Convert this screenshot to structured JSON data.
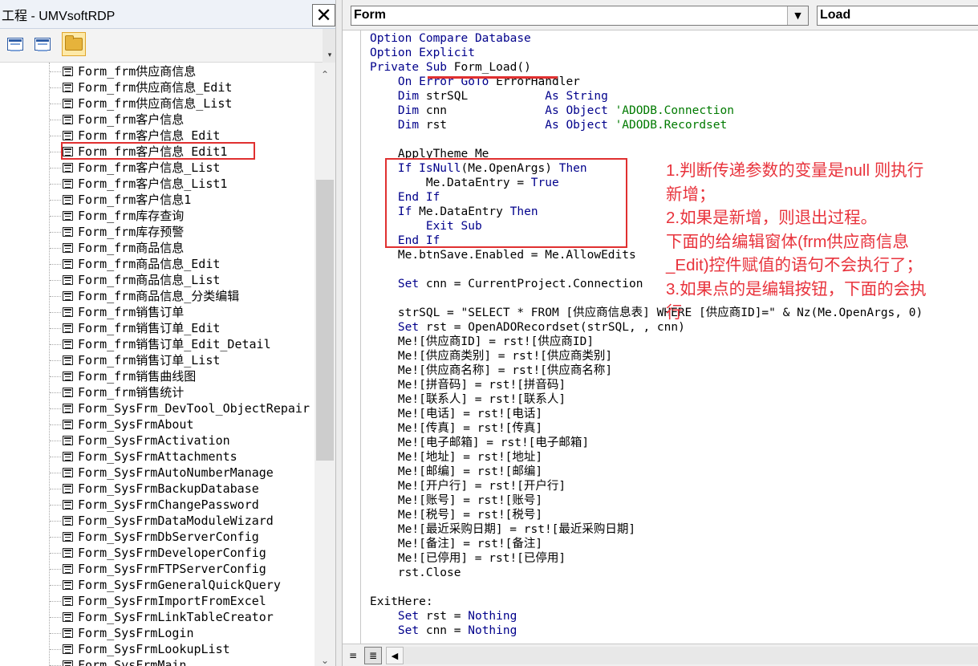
{
  "project_pane": {
    "title": "工程 - UMVsoftRDP",
    "close_glyph": "✕",
    "toolbar": {
      "view_object_icon": "view-object-icon",
      "view_code_icon": "view-code-icon",
      "toggle_folders_icon": "folder-icon"
    },
    "items": [
      "Form_frm供应商信息",
      "Form_frm供应商信息_Edit",
      "Form_frm供应商信息_List",
      "Form_frm客户信息",
      "Form_frm客户信息_Edit",
      "Form_frm客户信息_Edit1",
      "Form_frm客户信息_List",
      "Form_frm客户信息_List1",
      "Form_frm客户信息1",
      "Form_frm库存查询",
      "Form_frm库存预警",
      "Form_frm商品信息",
      "Form_frm商品信息_Edit",
      "Form_frm商品信息_List",
      "Form_frm商品信息_分类编辑",
      "Form_frm销售订单",
      "Form_frm销售订单_Edit",
      "Form_frm销售订单_Edit_Detail",
      "Form_frm销售订单_List",
      "Form_frm销售曲线图",
      "Form_frm销售统计",
      "Form_SysFrm_DevTool_ObjectRepair",
      "Form_SysFrmAbout",
      "Form_SysFrmActivation",
      "Form_SysFrmAttachments",
      "Form_SysFrmAutoNumberManage",
      "Form_SysFrmBackupDatabase",
      "Form_SysFrmChangePassword",
      "Form_SysFrmDataModuleWizard",
      "Form_SysFrmDbServerConfig",
      "Form_SysFrmDeveloperConfig",
      "Form_SysFrmFTPServerConfig",
      "Form_SysFrmGeneralQuickQuery",
      "Form_SysFrmImportFromExcel",
      "Form_SysFrmLinkTableCreator",
      "Form_SysFrmLogin",
      "Form_SysFrmLookupList",
      "Form_SysFrmMain"
    ],
    "highlighted_item": "Form_frm供应商信息_Edit"
  },
  "code_pane": {
    "object_combo": "Form",
    "procedure_combo": "Load",
    "dropdown_glyph": "▼",
    "lines": [
      [
        [
          "Option Compare Database",
          "kw"
        ]
      ],
      [
        [
          "Option Explicit",
          "kw"
        ]
      ],
      [
        [
          "Private Sub ",
          "kw"
        ],
        [
          "Form_Load()",
          ""
        ]
      ],
      [
        [
          "    ",
          ""
        ],
        [
          "On Error GoTo ",
          "kw"
        ],
        [
          "ErrorHandler",
          ""
        ]
      ],
      [
        [
          "    ",
          ""
        ],
        [
          "Dim ",
          "kw"
        ],
        [
          "strSQL           ",
          ""
        ],
        [
          "As String",
          "kw"
        ]
      ],
      [
        [
          "    ",
          ""
        ],
        [
          "Dim ",
          "kw"
        ],
        [
          "cnn              ",
          ""
        ],
        [
          "As Object ",
          "kw"
        ],
        [
          "'ADODB.Connection",
          "cm"
        ]
      ],
      [
        [
          "    ",
          ""
        ],
        [
          "Dim ",
          "kw"
        ],
        [
          "rst              ",
          ""
        ],
        [
          "As Object ",
          "kw"
        ],
        [
          "'ADODB.Recordset",
          "cm"
        ]
      ],
      [
        [
          "",
          ""
        ]
      ],
      [
        [
          "    ApplyTheme Me",
          ""
        ]
      ],
      [
        [
          "    ",
          ""
        ],
        [
          "If IsNull",
          "kw"
        ],
        [
          "(Me.OpenArgs) ",
          ""
        ],
        [
          "Then",
          "kw"
        ]
      ],
      [
        [
          "        Me.DataEntry = ",
          ""
        ],
        [
          "True",
          "kw"
        ]
      ],
      [
        [
          "    ",
          ""
        ],
        [
          "End If",
          "kw"
        ]
      ],
      [
        [
          "    ",
          ""
        ],
        [
          "If ",
          "kw"
        ],
        [
          "Me.DataEntry ",
          ""
        ],
        [
          "Then",
          "kw"
        ]
      ],
      [
        [
          "        ",
          ""
        ],
        [
          "Exit Sub",
          "kw"
        ]
      ],
      [
        [
          "    ",
          ""
        ],
        [
          "End If",
          "kw"
        ]
      ],
      [
        [
          "    Me.btnSave.Enabled = Me.AllowEdits",
          ""
        ]
      ],
      [
        [
          "",
          ""
        ]
      ],
      [
        [
          "    ",
          ""
        ],
        [
          "Set ",
          "kw"
        ],
        [
          "cnn = CurrentProject.Connection",
          ""
        ]
      ],
      [
        [
          "",
          ""
        ]
      ],
      [
        [
          "    strSQL = \"SELECT * FROM [供应商信息表] WHERE [供应商ID]=\" & Nz(Me.OpenArgs, 0)",
          ""
        ]
      ],
      [
        [
          "    ",
          ""
        ],
        [
          "Set ",
          "kw"
        ],
        [
          "rst = OpenADORecordset(strSQL, , cnn)",
          ""
        ]
      ],
      [
        [
          "    Me![供应商ID] = rst![供应商ID]",
          ""
        ]
      ],
      [
        [
          "    Me![供应商类别] = rst![供应商类别]",
          ""
        ]
      ],
      [
        [
          "    Me![供应商名称] = rst![供应商名称]",
          ""
        ]
      ],
      [
        [
          "    Me![拼音码] = rst![拼音码]",
          ""
        ]
      ],
      [
        [
          "    Me![联系人] = rst![联系人]",
          ""
        ]
      ],
      [
        [
          "    Me![电话] = rst![电话]",
          ""
        ]
      ],
      [
        [
          "    Me![传真] = rst![传真]",
          ""
        ]
      ],
      [
        [
          "    Me![电子邮箱] = rst![电子邮箱]",
          ""
        ]
      ],
      [
        [
          "    Me![地址] = rst![地址]",
          ""
        ]
      ],
      [
        [
          "    Me![邮编] = rst![邮编]",
          ""
        ]
      ],
      [
        [
          "    Me![开户行] = rst![开户行]",
          ""
        ]
      ],
      [
        [
          "    Me![账号] = rst![账号]",
          ""
        ]
      ],
      [
        [
          "    Me![税号] = rst![税号]",
          ""
        ]
      ],
      [
        [
          "    Me![最近采购日期] = rst![最近采购日期]",
          ""
        ]
      ],
      [
        [
          "    Me![备注] = rst![备注]",
          ""
        ]
      ],
      [
        [
          "    Me![已停用] = rst![已停用]",
          ""
        ]
      ],
      [
        [
          "    rst.Close",
          ""
        ]
      ],
      [
        [
          "",
          ""
        ]
      ],
      [
        [
          "ExitHere:",
          ""
        ]
      ],
      [
        [
          "    ",
          ""
        ],
        [
          "Set ",
          "kw"
        ],
        [
          "rst = ",
          ""
        ],
        [
          "Nothing",
          "kw"
        ]
      ],
      [
        [
          "    ",
          ""
        ],
        [
          "Set ",
          "kw"
        ],
        [
          "cnn = ",
          ""
        ],
        [
          "Nothing",
          "kw"
        ]
      ]
    ],
    "annotation": [
      "1.判断传递参数的变量是null 则执行",
      "新增；",
      "2.如果是新增，则退出过程。",
      "下面的给编辑窗体(frm供应商信息",
      "_Edit)控件赋值的语句不会执行了；",
      "3.如果点的是编辑按钮，下面的会执",
      "行"
    ],
    "annotation_color": "#e8333c",
    "keyword_color": "#00008b",
    "comment_color": "#007a00"
  }
}
